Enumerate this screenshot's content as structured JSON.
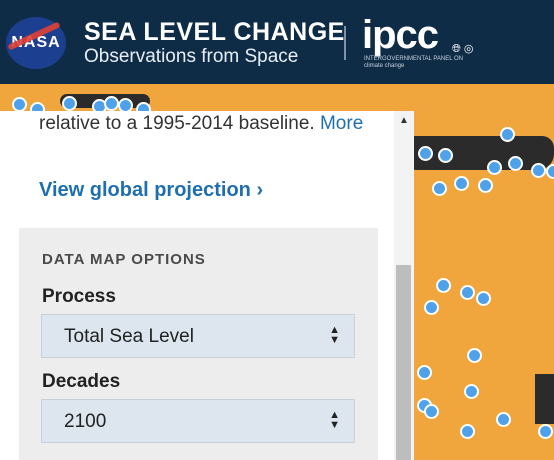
{
  "header": {
    "nasa_logo_text": "NASA",
    "title": "SEA LEVEL CHANGE",
    "subtitle": "Observations from Space",
    "ipcc_logo_text": "ipcc",
    "ipcc_small_text": "INTERGOVERNMENTAL PANEL ON climate change"
  },
  "panel": {
    "description": "relative to a 1995-2014 baseline.",
    "more_link": "More",
    "view_link": "View global projection ›",
    "options_title": "DATA MAP OPTIONS",
    "process_label": "Process",
    "process_value": "Total Sea Level",
    "decades_label": "Decades",
    "decades_value": "2100"
  },
  "colors": {
    "header_bg": "#0f2c47",
    "map_bg": "#f1a63d",
    "marker": "#4fa2ea",
    "link": "#1f6fb0"
  }
}
